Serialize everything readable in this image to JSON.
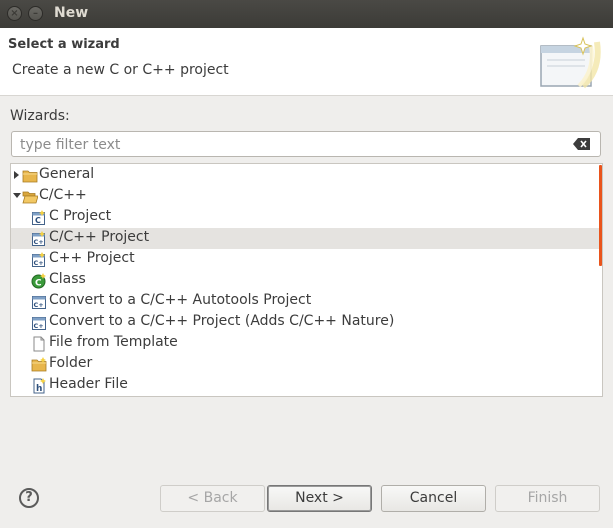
{
  "window": {
    "title": "New",
    "close_glyph": "×",
    "min_glyph": "–"
  },
  "header": {
    "title": "Select a wizard",
    "description": "Create a new C or C++ project",
    "banner_icon": "new-wizard-banner-icon"
  },
  "wizards_label": "Wizards:",
  "filter": {
    "value": "",
    "placeholder": "type filter text",
    "clear_icon": "clear-filter-icon"
  },
  "tree": {
    "items": [
      {
        "label": "General",
        "level": 0,
        "expanded": false,
        "icon": "folder-icon"
      },
      {
        "label": "C/C++",
        "level": 0,
        "expanded": true,
        "icon": "folder-open-icon"
      },
      {
        "label": "C Project",
        "level": 1,
        "icon": "c-project-icon"
      },
      {
        "label": "C/C++ Project",
        "level": 1,
        "icon": "cpp-project-icon",
        "selected": true
      },
      {
        "label": "C++ Project",
        "level": 1,
        "icon": "cpp-project-icon"
      },
      {
        "label": "Class",
        "level": 1,
        "icon": "class-icon"
      },
      {
        "label": "Convert to a C/C++ Autotools Project",
        "level": 1,
        "icon": "convert-project-icon"
      },
      {
        "label": "Convert to a C/C++ Project (Adds C/C++ Nature)",
        "level": 1,
        "icon": "convert-project-icon"
      },
      {
        "label": "File from Template",
        "level": 1,
        "icon": "file-icon"
      },
      {
        "label": "Folder",
        "level": 1,
        "icon": "folder-icon"
      },
      {
        "label": "Header File",
        "level": 1,
        "icon": "header-file-icon"
      }
    ]
  },
  "buttons": {
    "help": "?",
    "back": "< Back",
    "next": "Next >",
    "cancel": "Cancel",
    "finish": "Finish"
  },
  "colors": {
    "titlebar": "#3c3b37",
    "selection": "#e5e3e0",
    "scroll_accent": "#e9541c"
  }
}
